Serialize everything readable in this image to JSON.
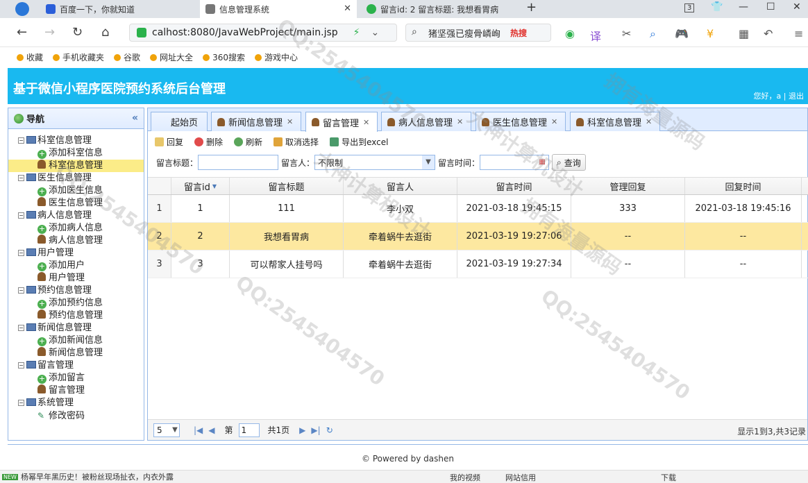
{
  "browser": {
    "tabs": [
      {
        "label": "百度一下，你就知道"
      },
      {
        "label": "信息管理系统"
      },
      {
        "label": "留言id: 2 留言标题: 我想看胃病"
      }
    ],
    "tab_count": "3",
    "url": "calhost:8080/JavaWebProject/main.jsp",
    "search_text": "猪坚强已瘦骨嶙峋",
    "search_hot": "热搜",
    "bookmarks": [
      "收藏",
      "手机收藏夹",
      "谷歌",
      "网址大全",
      "360搜索",
      "游戏中心"
    ]
  },
  "app": {
    "title": "基于微信小程序医院预约系统后台管理",
    "greeting": "您好，a | 退出"
  },
  "sidebar": {
    "title": "导航",
    "groups": [
      {
        "label": "科室信息管理",
        "children": [
          {
            "label": "添加科室信息",
            "icon": "add"
          },
          {
            "label": "科室信息管理",
            "icon": "user"
          }
        ]
      },
      {
        "label": "医生信息管理",
        "children": [
          {
            "label": "添加医生信息",
            "icon": "add"
          },
          {
            "label": "医生信息管理",
            "icon": "user"
          }
        ]
      },
      {
        "label": "病人信息管理",
        "children": [
          {
            "label": "添加病人信息",
            "icon": "add"
          },
          {
            "label": "病人信息管理",
            "icon": "user"
          }
        ]
      },
      {
        "label": "用户管理",
        "children": [
          {
            "label": "添加用户",
            "icon": "add"
          },
          {
            "label": "用户管理",
            "icon": "user"
          }
        ]
      },
      {
        "label": "预约信息管理",
        "children": [
          {
            "label": "添加预约信息",
            "icon": "add"
          },
          {
            "label": "预约信息管理",
            "icon": "user"
          }
        ]
      },
      {
        "label": "新闻信息管理",
        "children": [
          {
            "label": "添加新闻信息",
            "icon": "add"
          },
          {
            "label": "新闻信息管理",
            "icon": "user"
          }
        ]
      },
      {
        "label": "留言管理",
        "children": [
          {
            "label": "添加留言",
            "icon": "add"
          },
          {
            "label": "留言管理",
            "icon": "user"
          }
        ]
      },
      {
        "label": "系统管理",
        "children": [
          {
            "label": "修改密码",
            "icon": "pen"
          }
        ]
      }
    ]
  },
  "tabs": [
    {
      "label": "起始页",
      "closable": false
    },
    {
      "label": "新闻信息管理",
      "closable": true
    },
    {
      "label": "留言管理",
      "closable": true
    },
    {
      "label": "病人信息管理",
      "closable": true
    },
    {
      "label": "医生信息管理",
      "closable": true
    },
    {
      "label": "科室信息管理",
      "closable": true
    }
  ],
  "toolbar": {
    "reply": "回复",
    "delete": "删除",
    "refresh": "刷新",
    "cancel_select": "取消选择",
    "export": "导出到excel"
  },
  "filters": {
    "title_label": "留言标题：",
    "person_label": "留言人：",
    "person_value": "不限制",
    "time_label": "留言时间：",
    "query": "查询"
  },
  "grid": {
    "columns": [
      "留言id",
      "留言标题",
      "留言人",
      "留言时间",
      "管理回复",
      "回复时间"
    ],
    "rows": [
      {
        "n": "1",
        "id": "1",
        "title": "111",
        "person": "李小双",
        "time": "2021-03-18 19:45:15",
        "reply": "333",
        "reply_time": "2021-03-18 19:45:16"
      },
      {
        "n": "2",
        "id": "2",
        "title": "我想看胃病",
        "person": "牵着蜗牛去逛街",
        "time": "2021-03-19 19:27:06",
        "reply": "--",
        "reply_time": "--"
      },
      {
        "n": "3",
        "id": "3",
        "title": "可以帮家人挂号吗",
        "person": "牵着蜗牛去逛街",
        "time": "2021-03-19 19:27:34",
        "reply": "--",
        "reply_time": "--"
      }
    ]
  },
  "pager": {
    "page_size": "5",
    "page_prefix": "第",
    "page_value": "1",
    "total_pages": "共1页",
    "info": "显示1到3,共3记录"
  },
  "footer": "© Powered by dashen",
  "statusbar": {
    "news_badge": "NEW",
    "news": "杨幂早年黑历史！被粉丝现场扯衣，内衣外露",
    "my_video": "我的视频",
    "site_trust": "网站信用",
    "download": "下载"
  },
  "watermarks": [
    "QQ:2545404570",
    "大神计算机设计",
    "拥有海量源码"
  ],
  "colors": {
    "header": "#19b9f0",
    "selected_row": "#fde8a0",
    "tree_selected": "#fbec88",
    "border": "#95b8e7"
  }
}
